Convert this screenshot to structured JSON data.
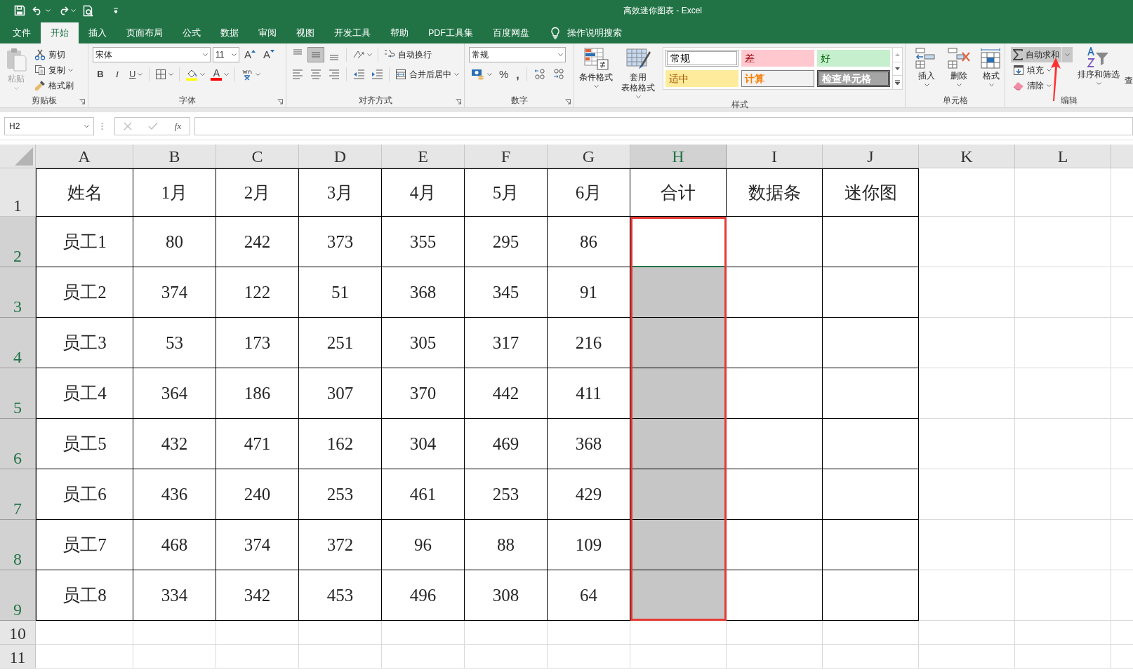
{
  "window": {
    "title": "高效迷你图表 - Excel"
  },
  "tabs": [
    {
      "label": "文件",
      "selected": false
    },
    {
      "label": "开始",
      "selected": true
    },
    {
      "label": "插入",
      "selected": false
    },
    {
      "label": "页面布局",
      "selected": false
    },
    {
      "label": "公式",
      "selected": false
    },
    {
      "label": "数据",
      "selected": false
    },
    {
      "label": "审阅",
      "selected": false
    },
    {
      "label": "视图",
      "selected": false
    },
    {
      "label": "开发工具",
      "selected": false
    },
    {
      "label": "帮助",
      "selected": false
    },
    {
      "label": "PDF工具集",
      "selected": false
    },
    {
      "label": "百度网盘",
      "selected": false
    }
  ],
  "tell_me": {
    "label": "操作说明搜索"
  },
  "ribbon": {
    "clipboard": {
      "label": "剪贴板",
      "paste": {
        "label": "粘贴",
        "disabled": true
      },
      "cut": "剪切",
      "copy": "复制",
      "format_painter": "格式刷"
    },
    "font": {
      "label": "字体",
      "font_name": "宋体",
      "font_size": "11",
      "grow": "A",
      "shrink": "A",
      "bold": "B",
      "italic": "I",
      "underline": "U",
      "font_color": "A"
    },
    "alignment": {
      "label": "对齐方式",
      "vertical_align": [
        {
          "selected": false
        },
        {
          "selected": true
        },
        {
          "selected": false
        }
      ],
      "wrap_text": "自动换行",
      "merge_center": "合并后居中"
    },
    "number": {
      "label": "数字",
      "format": "常规",
      "percent": "%",
      "comma": ","
    },
    "styles": {
      "label": "样式",
      "conditional_formatting": "条件格式",
      "format_as_table": [
        "套用",
        "表格格式"
      ],
      "cell_styles": [
        {
          "label": "常规",
          "kind": "normal"
        },
        {
          "label": "差",
          "kind": "bad"
        },
        {
          "label": "好",
          "kind": "good"
        },
        {
          "label": "适中",
          "kind": "neutral"
        },
        {
          "label": "计算",
          "kind": "calculation"
        },
        {
          "label": "检查单元格",
          "kind": "check"
        }
      ]
    },
    "cells": {
      "label": "单元格",
      "buttons": [
        "插入",
        "删除",
        "格式"
      ]
    },
    "editing": {
      "label": "编辑",
      "autosum": {
        "label": "自动求和",
        "highlighted": true
      },
      "fill": "填充",
      "clear": "清除",
      "sort_filter": "排序和筛选",
      "find_select": "查"
    }
  },
  "formula_bar": {
    "name_box": "H2",
    "function_label": "fx"
  },
  "sheet": {
    "columns": [
      {
        "label": "A",
        "selected": false
      },
      {
        "label": "B",
        "selected": false
      },
      {
        "label": "C",
        "selected": false
      },
      {
        "label": "D",
        "selected": false
      },
      {
        "label": "E",
        "selected": false
      },
      {
        "label": "F",
        "selected": false
      },
      {
        "label": "G",
        "selected": false
      },
      {
        "label": "H",
        "selected": true
      },
      {
        "label": "I",
        "selected": false
      },
      {
        "label": "J",
        "selected": false
      },
      {
        "label": "K",
        "selected": false
      },
      {
        "label": "L",
        "selected": false
      }
    ],
    "rows": [
      {
        "label": "1",
        "selected": false,
        "active": false,
        "cells": [
          "姓名",
          "1月",
          "2月",
          "3月",
          "4月",
          "5月",
          "6月",
          "合计",
          "数据条",
          "迷你图"
        ]
      },
      {
        "label": "2",
        "selected": true,
        "active": true,
        "cells": [
          "员工1",
          "80",
          "242",
          "373",
          "355",
          "295",
          "86"
        ]
      },
      {
        "label": "3",
        "selected": true,
        "active": false,
        "cells": [
          "员工2",
          "374",
          "122",
          "51",
          "368",
          "345",
          "91"
        ]
      },
      {
        "label": "4",
        "selected": true,
        "active": false,
        "cells": [
          "员工3",
          "53",
          "173",
          "251",
          "305",
          "317",
          "216"
        ]
      },
      {
        "label": "5",
        "selected": true,
        "active": false,
        "cells": [
          "员工4",
          "364",
          "186",
          "307",
          "370",
          "442",
          "411"
        ]
      },
      {
        "label": "6",
        "selected": true,
        "active": false,
        "cells": [
          "员工5",
          "432",
          "471",
          "162",
          "304",
          "469",
          "368"
        ]
      },
      {
        "label": "7",
        "selected": true,
        "active": false,
        "cells": [
          "员工6",
          "436",
          "240",
          "253",
          "461",
          "253",
          "429"
        ]
      },
      {
        "label": "8",
        "selected": true,
        "active": false,
        "cells": [
          "员工7",
          "468",
          "374",
          "372",
          "96",
          "88",
          "109"
        ]
      },
      {
        "label": "9",
        "selected": true,
        "active": false,
        "cells": [
          "员工8",
          "334",
          "342",
          "453",
          "496",
          "308",
          "64"
        ]
      },
      {
        "label": "10",
        "selected": false,
        "active": false
      },
      {
        "label": "11",
        "selected": false,
        "active": false
      }
    ]
  },
  "annotations": {
    "selection_box": true,
    "pointer_arrow": true
  }
}
